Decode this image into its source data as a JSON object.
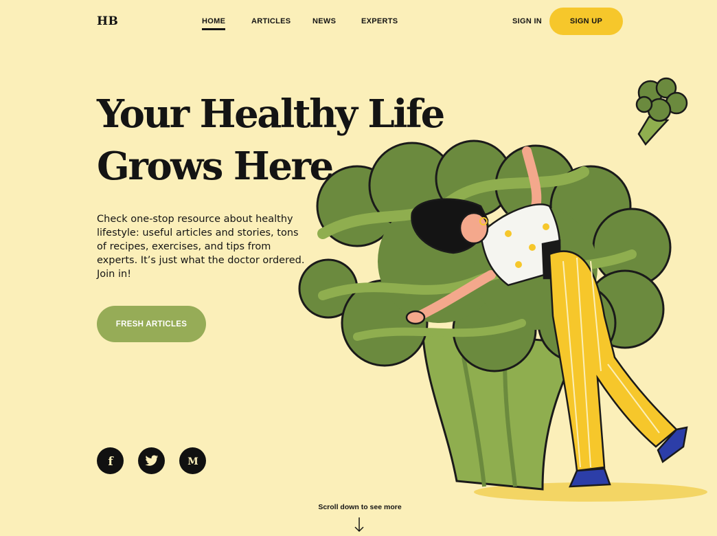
{
  "header": {
    "logo": "HB",
    "nav": [
      {
        "label": "HOME",
        "active": true
      },
      {
        "label": "ARTICLES",
        "active": false
      },
      {
        "label": "NEWS",
        "active": false
      },
      {
        "label": "EXPERTS",
        "active": false
      }
    ],
    "sign_in": "SIGN IN",
    "sign_up": "SIGN UP"
  },
  "hero": {
    "title_line1": "Your Healthy Life",
    "title_line2": "Grows Here",
    "description": "Check one-stop resource about healthy lifestyle: useful articles and stories, tons of recipes, exercises, and tips from experts. It’s just what the doctor ordered. Join in!",
    "cta": "FRESH ARTICLES"
  },
  "social": [
    {
      "icon": "facebook-icon",
      "glyph": "f"
    },
    {
      "icon": "twitter-icon",
      "glyph": ""
    },
    {
      "icon": "medium-icon",
      "glyph": "M"
    }
  ],
  "scroll": {
    "text": "Scroll down to see more",
    "icon": "arrow-down-icon"
  },
  "colors": {
    "background": "#fbefb9",
    "accent_yellow": "#f6c72b",
    "accent_green": "#96ac57",
    "broccoli_dark": "#6b8a3e",
    "broccoli_light": "#8fae4f",
    "text": "#141414"
  }
}
